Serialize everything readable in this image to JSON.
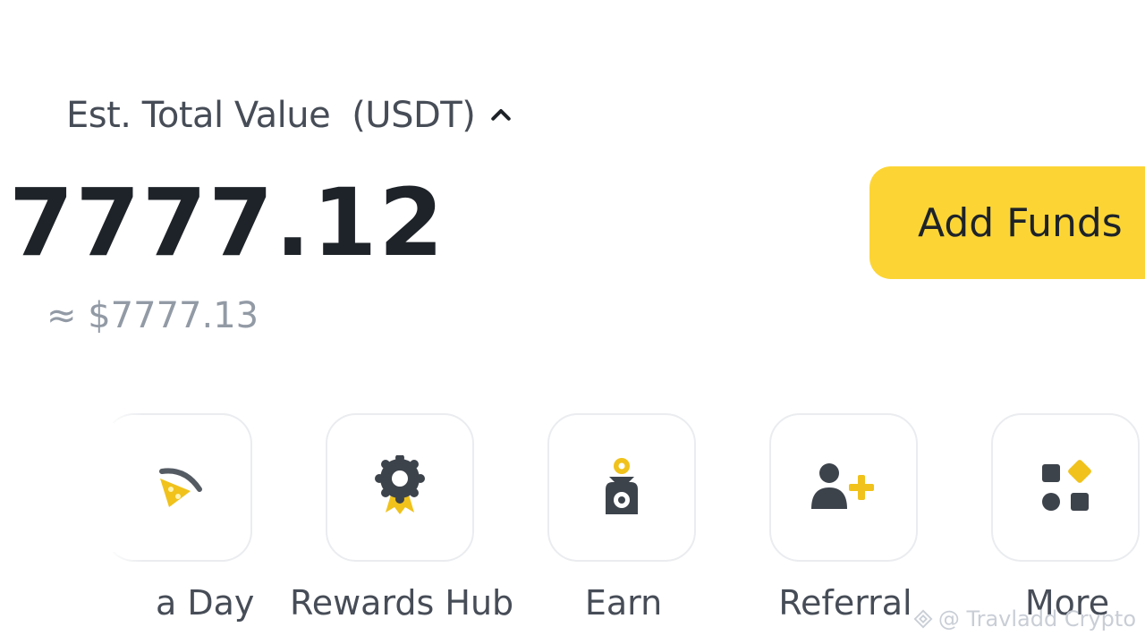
{
  "header": {
    "est_label": "Est. Total Value",
    "currency": "(USDT)",
    "caret_icon": "chevron-up-icon"
  },
  "balance": {
    "total": "7777.12",
    "approx": "≈ $7777.13"
  },
  "actions": {
    "add_funds_label": "Add Funds"
  },
  "shortcuts": [
    {
      "label": "a Day",
      "icon": "pizza-day-icon"
    },
    {
      "label": "Rewards Hub",
      "icon": "rewards-hub-icon"
    },
    {
      "label": "Earn",
      "icon": "earn-icon"
    },
    {
      "label": "Referral",
      "icon": "referral-icon"
    },
    {
      "label": "More",
      "icon": "more-grid-icon"
    }
  ],
  "watermark": {
    "text": "@ Travladd Crypto"
  },
  "colors": {
    "accent": "#FCD535",
    "text_primary": "#1E2329",
    "text_secondary": "#474D57",
    "text_muted": "#929AA5"
  }
}
